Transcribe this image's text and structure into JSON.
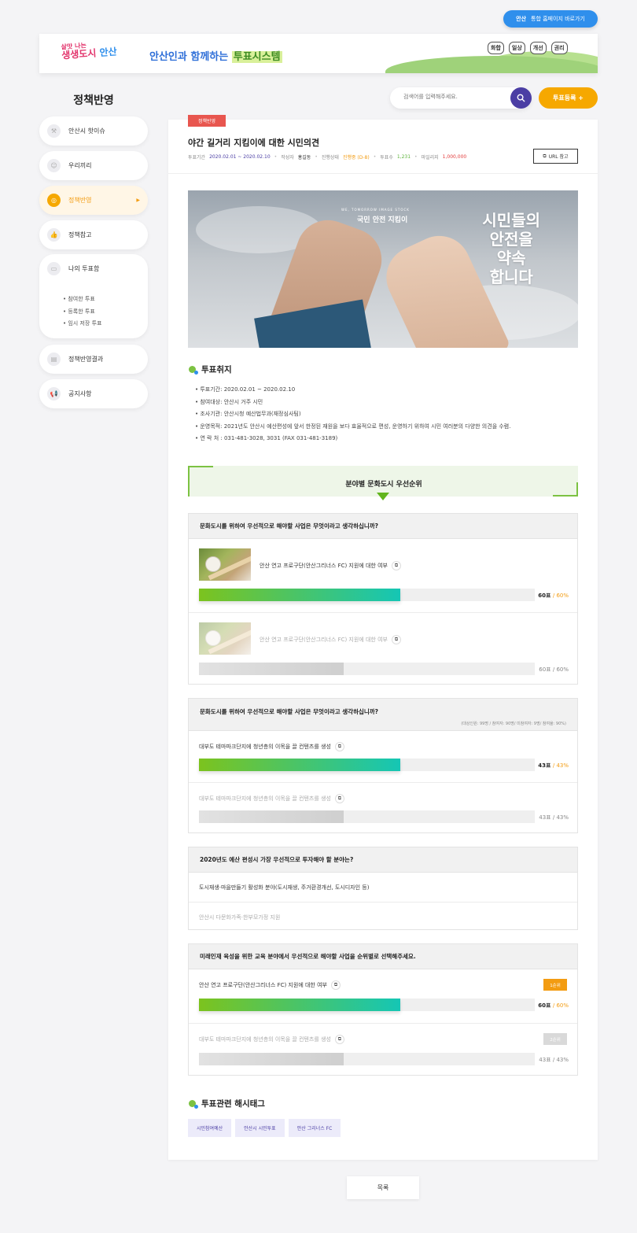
{
  "top_link": {
    "logo": "안산",
    "label": "통합 홈페이지 바로가기"
  },
  "banner": {
    "brand_line1": "살맛 나는",
    "brand_line2": "생생도시",
    "brand_line3": "안산",
    "title_plain": "안산인과 함께하는 ",
    "title_highlight": "투표시스템",
    "bubbles": [
      "화합",
      "권리",
      "일상",
      "개선"
    ]
  },
  "sidebar": {
    "title": "정책반영",
    "items": [
      {
        "label": "안산시 핫이슈"
      },
      {
        "label": "우리끼리"
      },
      {
        "label": "정책반영"
      },
      {
        "label": "정책참고"
      },
      {
        "label": "나의 투표함"
      },
      {
        "label": "정책반영결과"
      },
      {
        "label": "공지사항"
      }
    ],
    "sub_items": [
      "참여한 투표",
      "등록한 투표",
      "임시 저장 투표"
    ]
  },
  "search": {
    "placeholder": "검색어를 입력해주세요."
  },
  "register_button": "투표등록 +",
  "post": {
    "category": "정책반영",
    "title": "야간 길거리 지킴이에 대한 시민의견",
    "meta": {
      "period_label": "투표기간",
      "period": "2020.02.01 ~ 2020.02.10",
      "author_label": "작성자",
      "author": "홍길동",
      "status_label": "진행상태",
      "status": "진행중 (D-8)",
      "votes_label": "투표수",
      "votes": "1,231",
      "mileage_label": "마일리지",
      "mileage": "1,000,000"
    },
    "url_button": "URL 참고"
  },
  "hero": {
    "subcaption": "WE, TOMORROW IMAGE STOCK",
    "caption": "국민 안전 지킴이",
    "big_line1": "시민들의",
    "big_line2": "안전을",
    "big_line3": "약속",
    "big_line4": "합니다"
  },
  "purpose": {
    "heading": "투표취지",
    "items": [
      "투표기간: 2020.02.01 ~ 2020.02.10",
      "참여대상: 안산시 거주 시민",
      "조사기관: 안산시청 예산법무과(재정심사팀)",
      "운영목적: 2021년도 안산시 예산편성에 앞서 한정된 재원을 보다 효율적으로 편성, 운영하기 위하여 시민 여러분의 다양한 의견을 수렴.",
      "연 락 처 : 031-481-3028, 3031 (FAX 031-481-3189)"
    ]
  },
  "priority_banner": "분야별 문화도시 우선순위",
  "q1": {
    "question": "문화도시를 위하여 우선적으로 해야할 사업은 무엇이라고 생각하십니까?",
    "options": [
      {
        "text": "안산 연고 프로구단(안산그리너스 FC) 지원에 대한 여부",
        "votes": "60표",
        "pct": "60%",
        "fill": 60
      },
      {
        "text": "안산 연고 프로구단(안산그리너스 FC) 지원에 대한 여부",
        "votes": "60표",
        "pct": "60%",
        "fill": 43
      }
    ]
  },
  "q2": {
    "question": "문화도시를 위하여 우선적으로 해야할 사업은 무엇이라고 생각하십니까?",
    "sublabel": "(대상인원: 99명 / 참여자: 90명/ 미참여자: 9명/ 참여율: 90%)",
    "options": [
      {
        "text": "대부도 테마파크단지에 청년층의 이목을 끌 컨텐츠를 생성",
        "votes": "43표",
        "pct": "43%",
        "fill": 60
      },
      {
        "text": "대부도 테마파크단지에 청년층의 이목을 끌 컨텐츠를 생성",
        "votes": "43표",
        "pct": "43%",
        "fill": 43
      }
    ]
  },
  "q3": {
    "question": "2020년도 예산 편성시 가장 우선적으로 투자해야 할 분야는?",
    "options": [
      {
        "text": "도시재생·마을만들기 활성화 분야(도시재생, 주거환경개선, 도시디자인 등)"
      },
      {
        "text": "안산시 다문화가족·한부모가정 지원"
      }
    ]
  },
  "q4": {
    "question": "미래인재 육성을 위한 교육 분야에서 우선적으로 해야할 사업을 순위별로 선택해주세요.",
    "options": [
      {
        "text": "안산 연고 프로구단(안산그리너스 FC) 지원에 대한 여부",
        "rank": "1순위",
        "votes": "60표",
        "pct": "60%",
        "fill": 60
      },
      {
        "text": "대부도 테마파크단지에 청년층의 이목을 끌 컨텐츠를 생성",
        "rank": "2순위",
        "votes": "43표",
        "pct": "43%",
        "fill": 43
      }
    ]
  },
  "hashtags": {
    "heading": "투표관련 해시태그",
    "tags": [
      "시민참여예산",
      "안산시 시민투표",
      "안산 그리너스 FC"
    ]
  },
  "list_button": "목록",
  "colors": {
    "accent_orange": "#f6a800",
    "accent_purple": "#4b3ea4",
    "green": "#7cc242",
    "blue": "#2f8fec"
  }
}
